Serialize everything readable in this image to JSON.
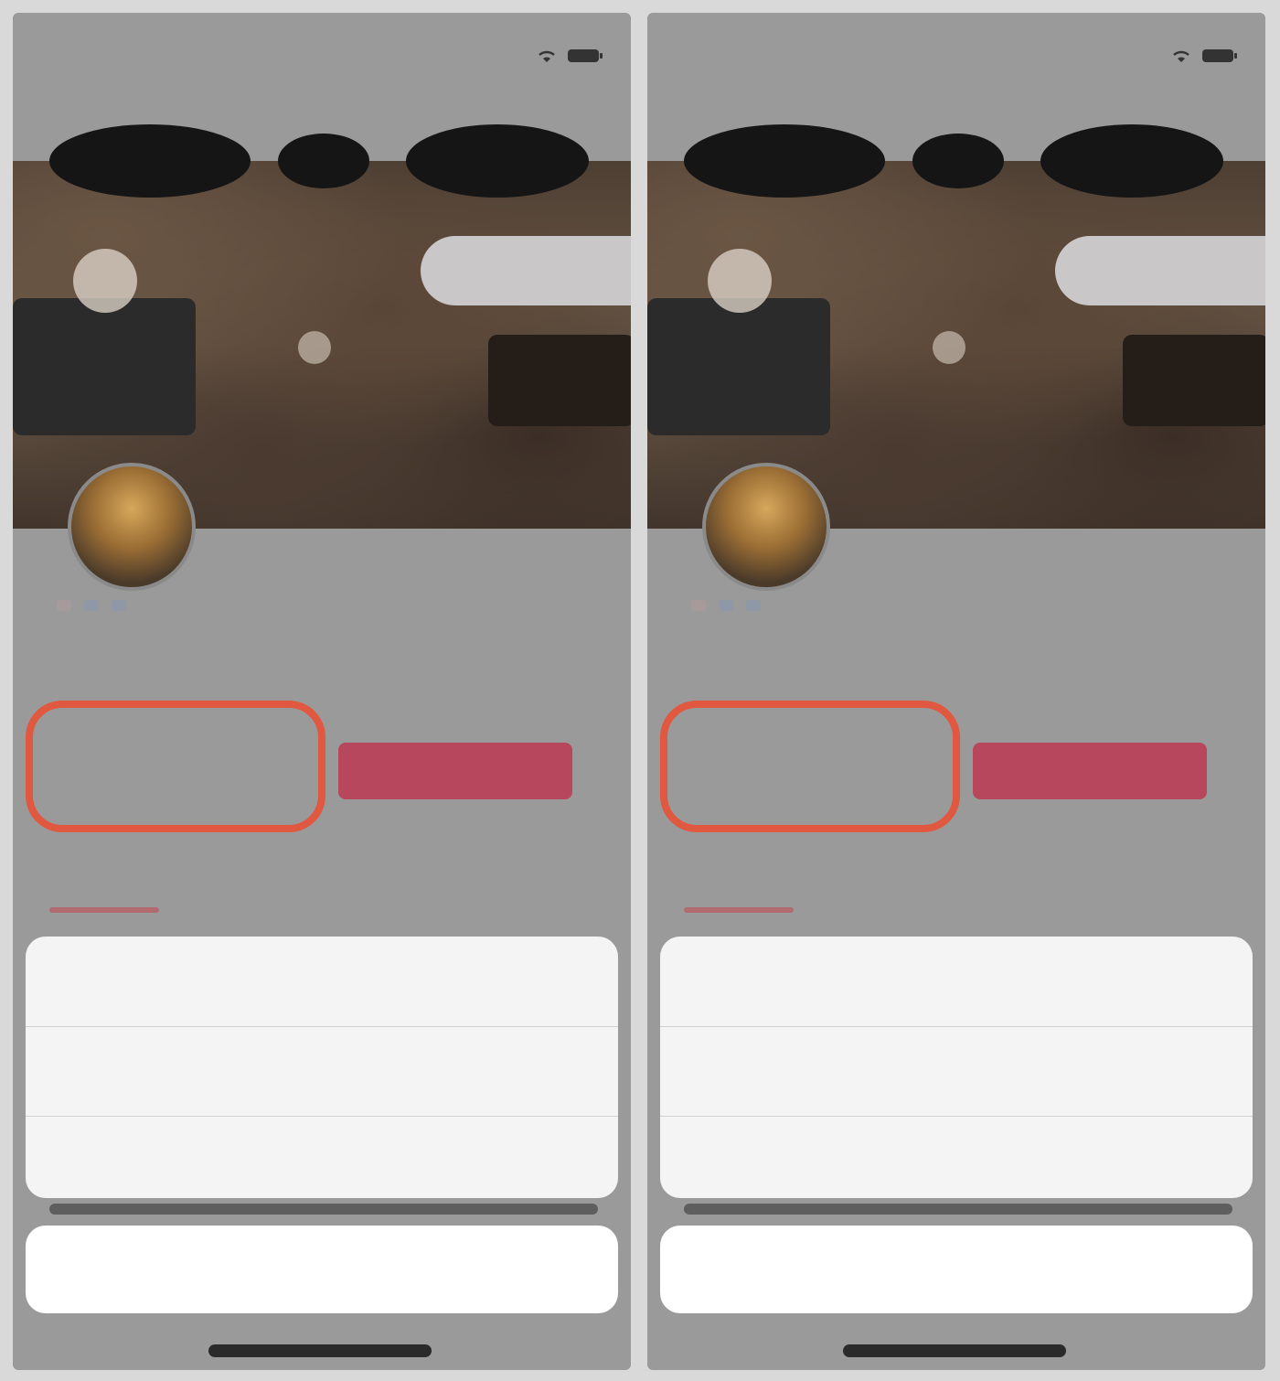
{
  "screens": [
    {
      "status_bar": {
        "time": ""
      },
      "nav": {
        "title": ""
      },
      "profile": {
        "follow_label": "",
        "tags": [
          "",
          "",
          ""
        ],
        "bio": "",
        "stats": [
          "",
          "",
          ""
        ],
        "chat_button": ""
      },
      "tabs": [
        "",
        "",
        "",
        ""
      ],
      "action_sheet": {
        "title": "",
        "actions": [
          "",
          ""
        ],
        "cancel": ""
      },
      "highlight": {
        "target": "stats",
        "color": "#e0583f"
      }
    },
    {
      "status_bar": {
        "time": ""
      },
      "nav": {
        "title": ""
      },
      "profile": {
        "follow_label": "",
        "tags": [
          "",
          "",
          ""
        ],
        "bio": "",
        "stats": [
          "",
          "",
          ""
        ],
        "chat_button": ""
      },
      "tabs": [
        "",
        "",
        "",
        ""
      ],
      "action_sheet": {
        "title": "",
        "actions": [
          "",
          ""
        ],
        "cancel": ""
      },
      "highlight": {
        "target": "stats",
        "color": "#e0583f"
      }
    }
  ],
  "colors": {
    "accent_red": "#b6475d",
    "link_blue": "#3f86d6",
    "highlight_orange": "#e0583f"
  }
}
